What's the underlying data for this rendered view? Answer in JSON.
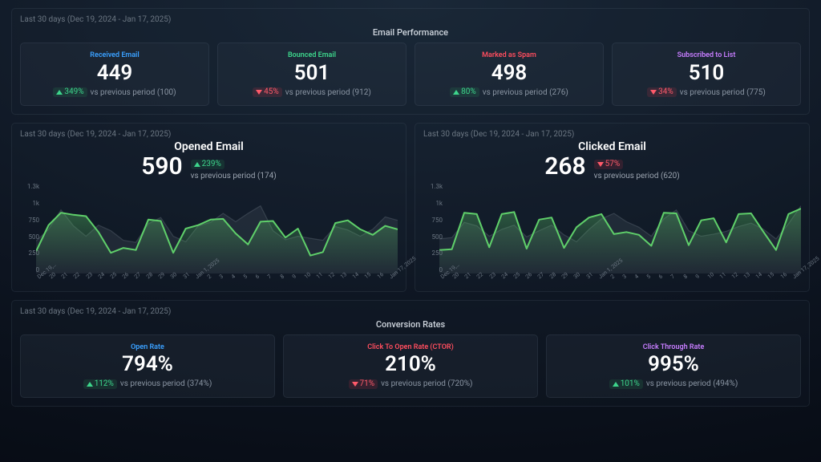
{
  "email_perf": {
    "range": "Last 30 days (Dec 19, 2024 - Jan 17, 2025)",
    "title": "Email Performance",
    "cards": [
      {
        "label": "Received Email",
        "value": "449",
        "delta": "349%",
        "dir": "up",
        "prev": "vs previous period (100)",
        "color": "c-blue"
      },
      {
        "label": "Bounced Email",
        "value": "501",
        "delta": "45%",
        "dir": "down",
        "prev": "vs previous period (912)",
        "color": "c-green"
      },
      {
        "label": "Marked as Spam",
        "value": "498",
        "delta": "80%",
        "dir": "up",
        "prev": "vs previous period (276)",
        "color": "c-red"
      },
      {
        "label": "Subscribed to List",
        "value": "510",
        "delta": "34%",
        "dir": "down",
        "prev": "vs previous period (775)",
        "color": "c-pink"
      }
    ]
  },
  "charts": [
    {
      "range": "Last 30 days (Dec 19, 2024 - Jan 17, 2025)",
      "title": "Opened Email",
      "value": "590",
      "delta": "239%",
      "dir": "up",
      "prev": "vs previous period (174)"
    },
    {
      "range": "Last 30 days (Dec 19, 2024 - Jan 17, 2025)",
      "title": "Clicked Email",
      "value": "268",
      "delta": "57%",
      "dir": "down",
      "prev": "vs previous period (620)"
    }
  ],
  "conversion": {
    "range": "Last 30 days (Dec 19, 2024 - Jan 17, 2025)",
    "title": "Conversion Rates",
    "cards": [
      {
        "label": "Open Rate",
        "value": "794%",
        "delta": "112%",
        "dir": "up",
        "prev": "vs previous period (374%)",
        "color": "c-blue"
      },
      {
        "label": "Click To Open Rate (CTOR)",
        "value": "210%",
        "delta": "71%",
        "dir": "down",
        "prev": "vs previous period (720%)",
        "color": "c-red"
      },
      {
        "label": "Click Through Rate",
        "value": "995%",
        "delta": "101%",
        "dir": "up",
        "prev": "vs previous period (494%)",
        "color": "c-pink"
      }
    ]
  },
  "chart_data": [
    {
      "type": "area",
      "title": "Opened Email",
      "ylim": [
        0,
        1300
      ],
      "yticks": [
        "1.3k",
        "1k",
        "750",
        "500",
        "250",
        "0"
      ],
      "categories": [
        "Dec 19,…",
        "20",
        "21",
        "22",
        "23",
        "24",
        "25",
        "26",
        "27",
        "28",
        "29",
        "30",
        "31",
        "Jan 1, 2025",
        "2",
        "3",
        "4",
        "5",
        "6",
        "7",
        "8",
        "9",
        "10",
        "11",
        "12",
        "13",
        "14",
        "15",
        "16",
        "Jan 17, 2025"
      ],
      "series": [
        {
          "name": "Opened Email (current)",
          "color": "#5fcf6a",
          "values": [
            320,
            700,
            880,
            850,
            830,
            600,
            300,
            370,
            340,
            780,
            760,
            300,
            650,
            700,
            780,
            790,
            580,
            420,
            750,
            760,
            520,
            650,
            260,
            310,
            730,
            770,
            640,
            560,
            690,
            640
          ]
        },
        {
          "name": "Opened Email (previous)",
          "color": "#6b7682",
          "values": [
            470,
            640,
            920,
            690,
            540,
            700,
            620,
            480,
            450,
            720,
            810,
            540,
            460,
            690,
            740,
            870,
            750,
            870,
            980,
            620,
            490,
            540,
            510,
            480,
            680,
            630,
            540,
            640,
            820,
            770
          ]
        }
      ]
    },
    {
      "type": "area",
      "title": "Clicked Email",
      "ylim": [
        0,
        1300
      ],
      "yticks": [
        "1.3k",
        "1k",
        "750",
        "500",
        "250",
        "0"
      ],
      "categories": [
        "Dec 19,…",
        "20",
        "21",
        "22",
        "23",
        "24",
        "25",
        "26",
        "27",
        "28",
        "29",
        "30",
        "31",
        "Jan 1, 2025",
        "2",
        "3",
        "4",
        "5",
        "6",
        "7",
        "8",
        "9",
        "10",
        "11",
        "12",
        "13",
        "14",
        "15",
        "16",
        "Jan 17, 2025"
      ],
      "series": [
        {
          "name": "Clicked Email (current)",
          "color": "#5fcf6a",
          "values": [
            340,
            350,
            880,
            860,
            380,
            860,
            890,
            360,
            780,
            810,
            370,
            670,
            810,
            860,
            570,
            600,
            560,
            400,
            880,
            870,
            410,
            770,
            800,
            450,
            860,
            870,
            600,
            340,
            860,
            940
          ]
        },
        {
          "name": "Clicked Email (previous)",
          "color": "#6b7682",
          "values": [
            500,
            520,
            740,
            690,
            540,
            640,
            700,
            530,
            620,
            700,
            560,
            460,
            640,
            790,
            870,
            750,
            670,
            540,
            790,
            920,
            620,
            540,
            570,
            610,
            680,
            730,
            640,
            500,
            720,
            980
          ]
        }
      ]
    }
  ]
}
